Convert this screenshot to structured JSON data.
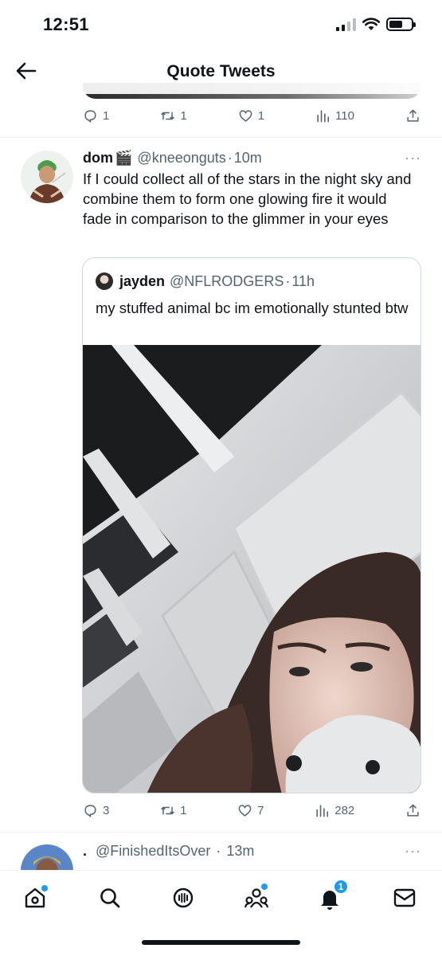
{
  "status_bar": {
    "time": "12:51"
  },
  "header": {
    "title": "Quote Tweets",
    "back_icon": "arrow-left-icon"
  },
  "prev_tweet": {
    "replies": "1",
    "retweets": "1",
    "likes": "1",
    "views": "110"
  },
  "tweet": {
    "name": "dom",
    "name_emoji": "🎬",
    "handle": "@kneeonguts",
    "sep": "·",
    "time": "10m",
    "more": "···",
    "text": "If I could collect all of the stars in the night sky and combine them to form one glowing fire it would fade in comparison to the glimmer in your eyes",
    "quote": {
      "name": "jayden",
      "handle": "@NFLRODGERS",
      "sep": "·",
      "time": "11h",
      "text": "my stuffed animal bc im emotionally stunted btw"
    },
    "stats": {
      "replies": "3",
      "retweets": "1",
      "likes": "7",
      "views": "282"
    }
  },
  "next_tweet": {
    "name": ".",
    "handle": "@FinishedItsOver",
    "sep": "·",
    "time": "13m",
    "more": "···"
  },
  "bottom_nav": {
    "items": [
      "home-icon",
      "search-icon",
      "spaces-icon",
      "communities-icon",
      "notifications-icon",
      "messages-icon"
    ],
    "notifications_badge": "1"
  },
  "colors": {
    "accent": "#1d9bf0",
    "text": "#0f1419",
    "muted": "#536471",
    "border": "#cfd9de"
  }
}
